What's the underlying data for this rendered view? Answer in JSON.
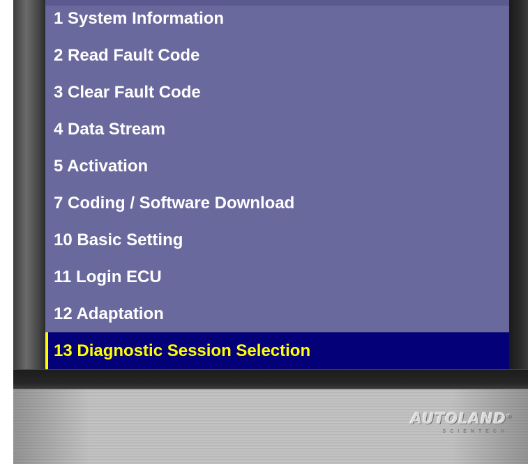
{
  "menu": {
    "items": [
      {
        "label": "1 System Information"
      },
      {
        "label": "2 Read Fault Code"
      },
      {
        "label": "3 Clear Fault Code"
      },
      {
        "label": "4 Data Stream"
      },
      {
        "label": "5 Activation"
      },
      {
        "label": "7 Coding / Software Download"
      },
      {
        "label": "10 Basic Setting"
      },
      {
        "label": "11 Login ECU"
      },
      {
        "label": "12 Adaptation"
      },
      {
        "label": "13 Diagnostic Session Selection",
        "selected": true
      }
    ]
  },
  "brand": {
    "name": "AUTOLAND",
    "registered_mark": "®",
    "tagline": "SCIENTECH"
  },
  "colors": {
    "screen_background": "#6a699d",
    "selection_background": "#030078",
    "selection_text": "#ffff00",
    "item_text": "#ffffff"
  }
}
